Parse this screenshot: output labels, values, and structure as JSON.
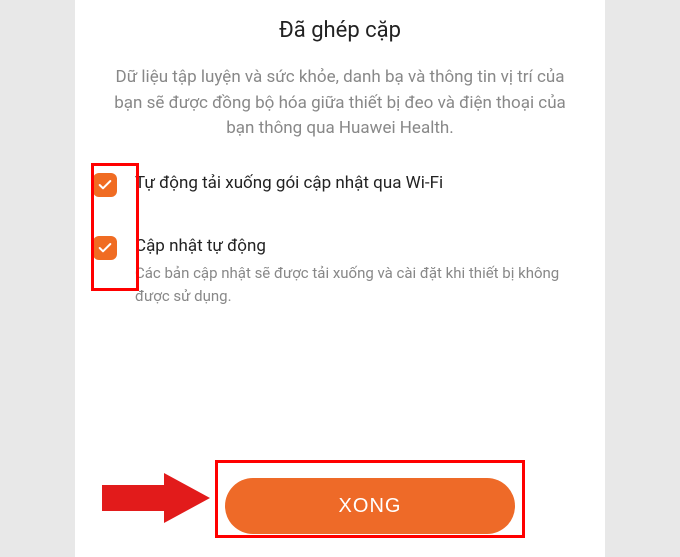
{
  "title": "Đã ghép cặp",
  "description": "Dữ liệu tập luyện và sức khỏe, danh bạ và thông tin vị trí của bạn sẽ được đồng bộ hóa giữa thiết bị đeo và điện thoại của bạn thông qua Huawei Health.",
  "options": [
    {
      "label": "Tự động tải xuống gói cập nhật qua Wi-Fi",
      "checked": true
    },
    {
      "label": "Cập nhật tự động",
      "sub": "Các bản cập nhật sẽ được tải xuống và cài đặt khi thiết bị không được sử dụng.",
      "checked": true
    }
  ],
  "buttons": {
    "done": "XONG"
  },
  "colors": {
    "accent": "#f06c23",
    "highlight": "#ff0000"
  }
}
